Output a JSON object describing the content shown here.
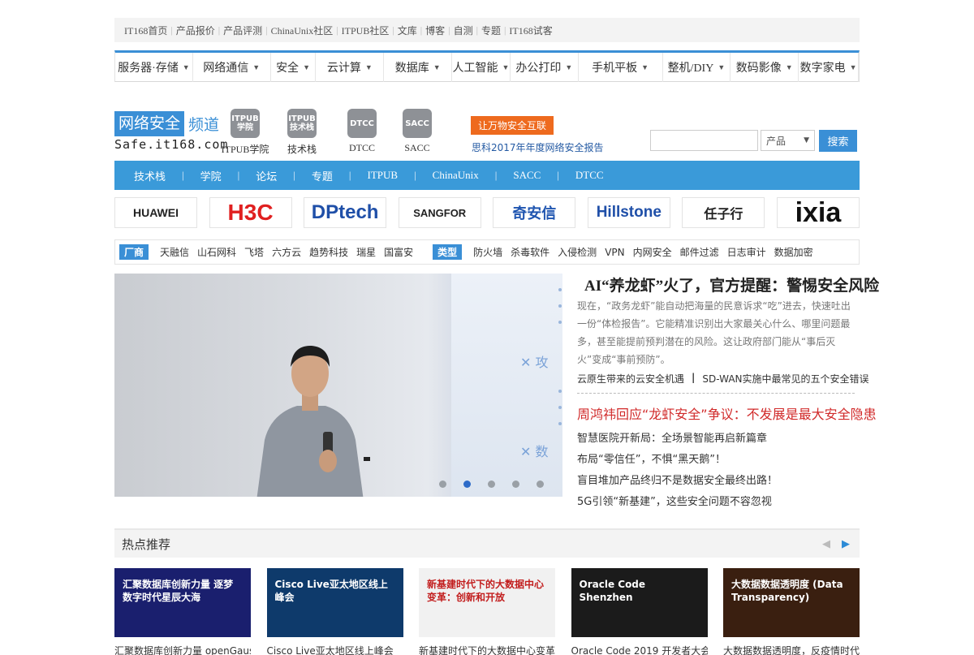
{
  "toplinks": [
    "IT168首页",
    "产品报价",
    "产品评测",
    "ChinaUnix社区",
    "ITPUB社区",
    "文库",
    "博客",
    "自测",
    "专题",
    "IT168试客"
  ],
  "mainnav": [
    {
      "label": "服务器·存储",
      "caret": true,
      "w": 96
    },
    {
      "label": "网络通信",
      "caret": true,
      "w": 96
    },
    {
      "label": "安全",
      "caret": true,
      "w": 56
    },
    {
      "label": "云计算",
      "caret": true,
      "w": 84
    },
    {
      "label": "数据库",
      "caret": true,
      "w": 84
    },
    {
      "label": "人工智能",
      "caret": true,
      "w": 72
    },
    {
      "label": "办公打印",
      "caret": true,
      "w": 84
    },
    {
      "label": "手机平板",
      "caret": true,
      "w": 104
    },
    {
      "label": "整机/DIY",
      "caret": true,
      "w": 84
    },
    {
      "label": "数码影像",
      "caret": true,
      "w": 84
    },
    {
      "label": "数字家电",
      "caret": true,
      "w": 74
    }
  ],
  "logo": {
    "badge": "网络安全",
    "sub": "频道",
    "url": "Safe.it168.com"
  },
  "channels": [
    {
      "icon": "ITPUB\n学院",
      "label": "ITPUB学院",
      "color": "#8e9196"
    },
    {
      "icon": "ITPUB\n技术栈",
      "label": "技术栈",
      "color": "#8e9196"
    },
    {
      "icon": "DTCC",
      "label": "DTCC",
      "color": "#8e9196"
    },
    {
      "icon": "SACC",
      "label": "SACC",
      "color": "#8e9196"
    }
  ],
  "promo": {
    "badge": "让万物安全互联",
    "text": "思科2017年年度网络安全报告"
  },
  "search": {
    "placeholder": "",
    "select": "产品",
    "button": "搜索"
  },
  "subnav": [
    "技术栈",
    "学院",
    "论坛",
    "专题",
    "ITPUB",
    "ChinaUnix",
    "SACC",
    "DTCC"
  ],
  "brands": [
    {
      "name": "HUAWEI",
      "color": "#222",
      "size": 14
    },
    {
      "name": "H3C",
      "color": "#e02020",
      "size": 28
    },
    {
      "name": "DPtech",
      "color": "#1f4fa8",
      "size": 24
    },
    {
      "name": "SANGFOR",
      "color": "#222",
      "size": 13
    },
    {
      "name": "奇安信",
      "color": "#1f55b0",
      "size": 18
    },
    {
      "name": "Hillstone",
      "color": "#1f4fa8",
      "size": 19
    },
    {
      "name": "任子行",
      "color": "#222",
      "size": 16
    },
    {
      "name": "ixia",
      "color": "#111",
      "size": 34
    }
  ],
  "tagbar": {
    "vendors_label": "厂商",
    "vendors": [
      "天融信",
      "山石网科",
      "飞塔",
      "六方云",
      "趋势科技",
      "瑞星",
      "国富安"
    ],
    "types_label": "类型",
    "types": [
      "防火墙",
      "杀毒软件",
      "入侵检测",
      "VPN",
      "内网安全",
      "邮件过滤",
      "日志审计",
      "数据加密"
    ]
  },
  "hero": {
    "headline": "AI“养龙虾”火了，官方提醒：警惕安全风险",
    "summary": "现在，“政务龙虾”能自动把海量的民意诉求“吃”进去，快速吐出一份“体检报告”。它能精准识别出大家最关心什么、哪里问题最多，甚至能提前预判潜在的风险。这让政府部门能从“事后灭火”变成“事前预防”。",
    "sublink1": "云原生带来的云安全机遇",
    "sublink_sep": "|",
    "sublink2": "SD-WAN实施中最常见的五个安全错误",
    "red_headline": "周鸿祎回应“龙虾安全”争议：不发展是最大安全隐患",
    "news": [
      "智慧医院开新局：全场景智能再启新篇章",
      "布局“零信任”，不惧“黑天鹅”！",
      "盲目堆加产品终归不是数据安全最终出路！",
      "5G引领“新基建”，这些安全问题不容忽视"
    ],
    "slide_count": 5,
    "slide_active": 1
  },
  "hot": {
    "title": "热点推荐",
    "prev": "◀",
    "next": "▶"
  },
  "cards": [
    {
      "title": "汇聚数据库创新力量 逐梦数字时代星辰大海",
      "caption": "汇聚数据库创新力量 openGauss",
      "bg": "#1a1f6e"
    },
    {
      "title": "Cisco Live亚太地区线上峰会",
      "caption": "Cisco Live亚太地区线上峰会",
      "bg": "#0e3a6b"
    },
    {
      "title": "新基建时代下的大数据中心变革：创新和开放",
      "caption": "新基建时代下的大数据中心变革",
      "bg": "#f1f1f1"
    },
    {
      "title": "Oracle Code Shenzhen",
      "caption": "Oracle Code 2019 开发者大会",
      "bg": "#1b1b1b"
    },
    {
      "title": "大数据数据透明度 (Data Transparency)",
      "caption": "大数据数据透明度，反疫情时代",
      "bg": "#3a1f10"
    }
  ],
  "colors": {
    "accent": "#3a8fd6",
    "promo": "#ee6a1e",
    "red": "#d12a2a"
  }
}
